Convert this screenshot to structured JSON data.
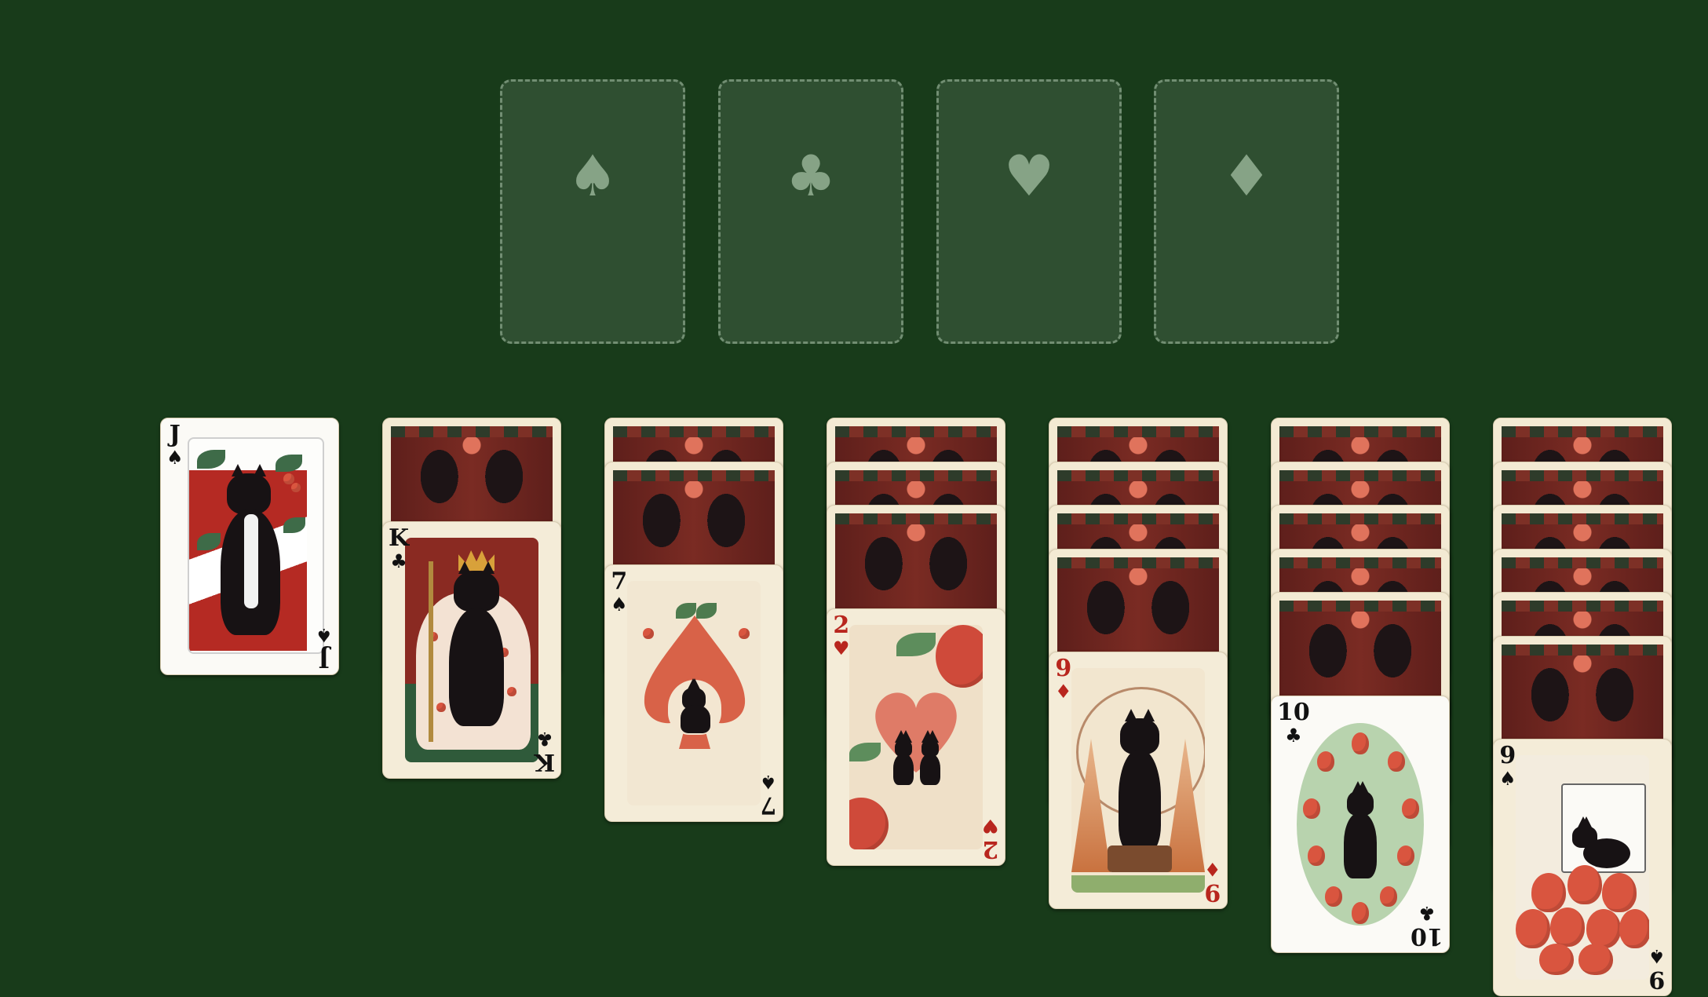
{
  "colors": {
    "table": "#183b1a",
    "slot_outline": "#aac3aa",
    "red_suit": "#b8261e",
    "black_suit": "#111111"
  },
  "foundations": [
    {
      "suit": "spades",
      "glyph": "♠"
    },
    {
      "suit": "clubs",
      "glyph": "♣"
    },
    {
      "suit": "hearts",
      "glyph": "♥"
    },
    {
      "suit": "diamonds",
      "glyph": "♦"
    }
  ],
  "stock": {
    "top_card": {
      "rank": "J",
      "suit": "♠",
      "suit_name": "spades",
      "color": "black",
      "art": "black and white cat with berries and leaves"
    }
  },
  "tableau": [
    {
      "hidden_count": 1,
      "top_card": {
        "rank": "K",
        "suit": "♣",
        "suit_name": "clubs",
        "color": "black",
        "art": "crowned cat king with strawberry cape"
      }
    },
    {
      "hidden_count": 2,
      "top_card": {
        "rank": "7",
        "suit": "♠",
        "suit_name": "spades",
        "color": "black",
        "art": "cat inside strawberry spade"
      }
    },
    {
      "hidden_count": 3,
      "top_card": {
        "rank": "2",
        "suit": "♥",
        "suit_name": "hearts",
        "color": "red",
        "art": "two cats forming heart on strawberry"
      }
    },
    {
      "hidden_count": 4,
      "top_card": {
        "rank": "9",
        "suit": "♦",
        "suit_name": "diamonds",
        "color": "red",
        "art": "cat sitting on tree stump"
      }
    },
    {
      "hidden_count": 5,
      "top_card": {
        "rank": "10",
        "suit": "♣",
        "suit_name": "clubs",
        "color": "black",
        "art": "cat ringed by strawberries"
      }
    },
    {
      "hidden_count": 6,
      "top_card": {
        "rank": "9",
        "suit": "♠",
        "suit_name": "spades",
        "color": "black",
        "art": "cat sleeping on strawberry pile"
      }
    }
  ]
}
